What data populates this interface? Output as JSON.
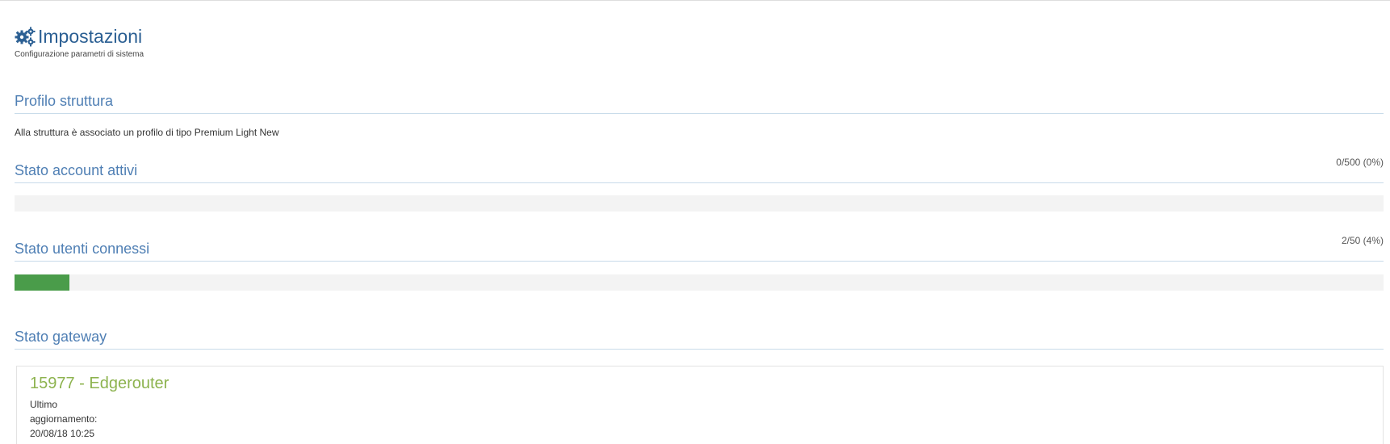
{
  "header": {
    "icon": "gears-icon",
    "title": "Impostazioni",
    "subtitle": "Configurazione parametri di sistema"
  },
  "profile": {
    "heading": "Profilo struttura",
    "text": "Alla struttura è associato un profilo di tipo Premium Light New"
  },
  "accounts": {
    "heading": "Stato account attivi",
    "value_text": "0/500 (0%)",
    "used": 0,
    "total": 500,
    "percent": 0
  },
  "users": {
    "heading": "Stato utenti connessi",
    "value_text": "2/50 (4%)",
    "used": 2,
    "total": 50,
    "percent": 4,
    "fill_color": "#4a9c4a"
  },
  "gateway": {
    "heading": "Stato gateway",
    "name": "15977 - Edgerouter",
    "last_update_label_1": "Ultimo",
    "last_update_label_2": "aggiornamento:",
    "last_update_value": "20/08/18 10:25"
  },
  "colors": {
    "accent": "#2b5f93",
    "heading": "#4f7fb4",
    "gateway_name": "#8db34f"
  }
}
